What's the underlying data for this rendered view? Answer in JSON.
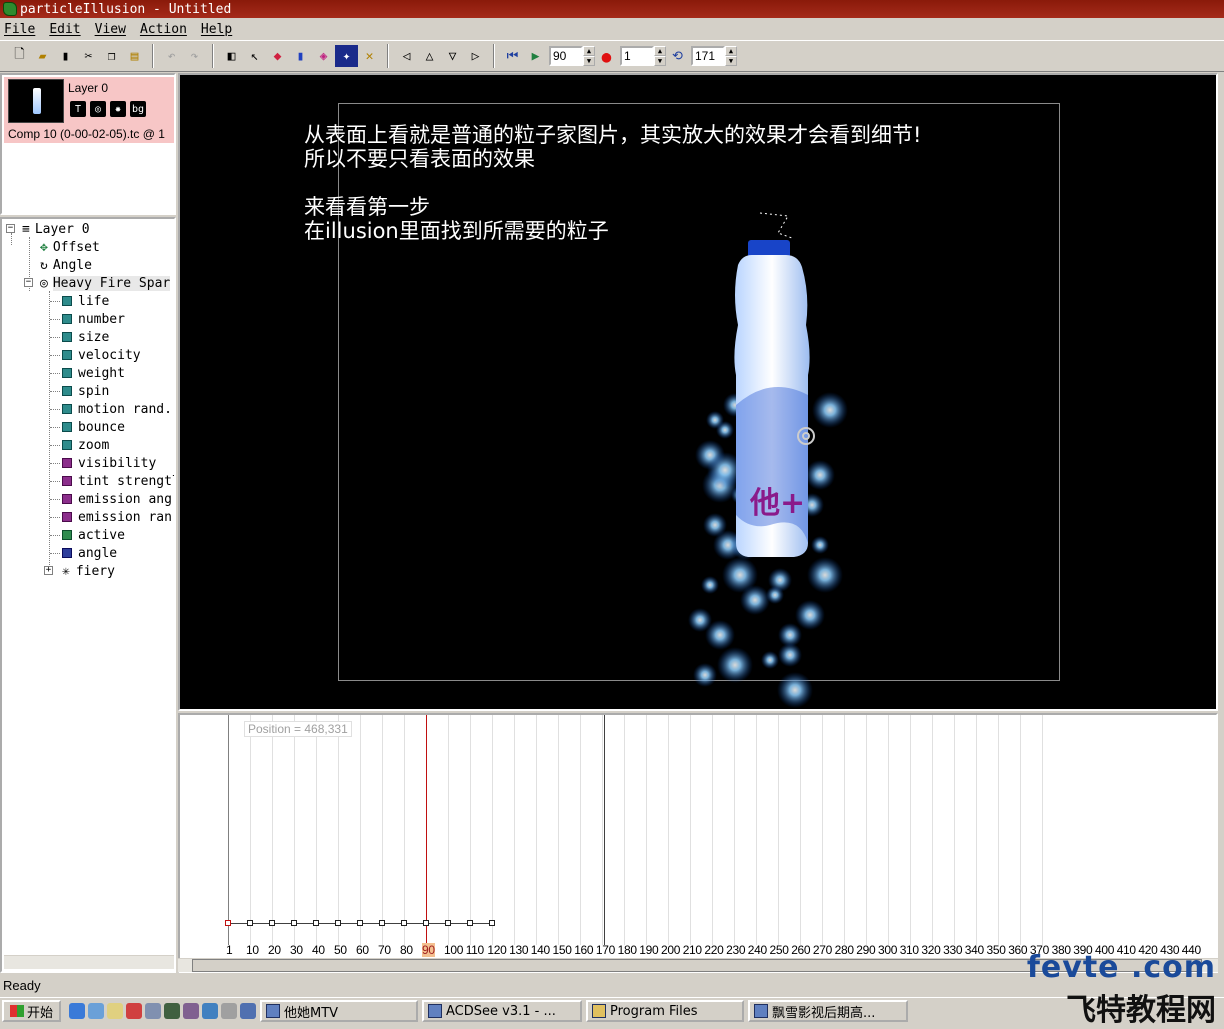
{
  "window": {
    "title": "particleIllusion - Untitled"
  },
  "menu": [
    "File",
    "Edit",
    "View",
    "Action",
    "Help"
  ],
  "toolbar": {
    "frame_value": "90",
    "record_value": "1",
    "loop_value": "171"
  },
  "layer": {
    "name": "Layer 0",
    "icons": [
      "T",
      "◎",
      "✸",
      "bg"
    ],
    "comp_label": "Comp 10 (0-00-02-05).tc @ 1"
  },
  "tree": {
    "root": "Layer 0",
    "offset": "Offset",
    "angle": "Angle",
    "emitter": "Heavy Fire Spar",
    "params": [
      {
        "label": "life",
        "color": "teal"
      },
      {
        "label": "number",
        "color": "teal"
      },
      {
        "label": "size",
        "color": "teal"
      },
      {
        "label": "velocity",
        "color": "teal"
      },
      {
        "label": "weight",
        "color": "teal"
      },
      {
        "label": "spin",
        "color": "teal"
      },
      {
        "label": "motion rand.",
        "color": "teal"
      },
      {
        "label": "bounce",
        "color": "teal"
      },
      {
        "label": "zoom",
        "color": "teal"
      },
      {
        "label": "visibility",
        "color": "purple"
      },
      {
        "label": "tint strengtl",
        "color": "purple"
      },
      {
        "label": "emission ang:",
        "color": "purple"
      },
      {
        "label": "emission ran;",
        "color": "purple"
      },
      {
        "label": "active",
        "color": "green"
      },
      {
        "label": "angle",
        "color": "blue"
      }
    ],
    "child": "fiery"
  },
  "canvas": {
    "line1": "从表面上看就是普通的粒子家图片，其实放大的效果才会看到细节!",
    "line2": "所以不要只看表面的效果",
    "line3": "来看看第一步",
    "line4": "在illusion里面找到所需要的粒子",
    "bottle_label": "他+"
  },
  "timeline": {
    "tooltip": "Position = 468,331",
    "current_frame": "90",
    "ticks": [
      "1",
      "10",
      "20",
      "30",
      "40",
      "50",
      "60",
      "70",
      "80",
      "90",
      "100",
      "110",
      "120",
      "130",
      "140",
      "150",
      "160",
      "170",
      "180",
      "190",
      "200",
      "210",
      "220",
      "230",
      "240",
      "250",
      "260",
      "270",
      "280",
      "290",
      "300",
      "310",
      "320",
      "330",
      "340",
      "350",
      "360",
      "370",
      "380",
      "390",
      "400",
      "410",
      "420",
      "430",
      "440"
    ]
  },
  "status": {
    "text": "Ready"
  },
  "taskbar": {
    "start": "开始",
    "tasks": [
      "他她MTV",
      "ACDSee v3.1 - ...",
      "Program Files",
      "飘雪影视后期高..."
    ]
  },
  "watermark": {
    "line1": "fevte .com",
    "line2": "飞特教程网"
  },
  "colors": {
    "titlebar": "#a52a1a",
    "layer_card": "#f7c6c6",
    "playhead": "#c01010",
    "canvas_bg": "#000000"
  }
}
